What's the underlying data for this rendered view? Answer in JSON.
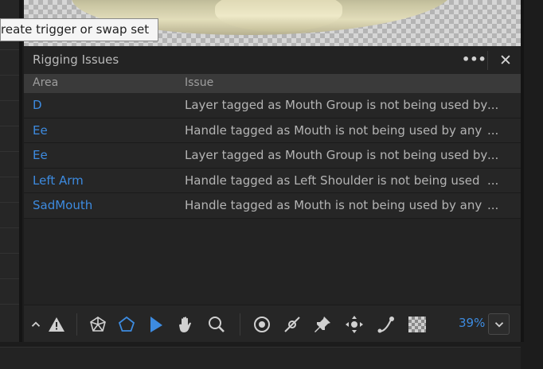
{
  "tooltip": {
    "text": "reate trigger or swap set"
  },
  "panel": {
    "title": "Rigging Issues",
    "more_label": "•••",
    "close_label": "✕"
  },
  "table": {
    "columns": [
      "Area",
      "Issue"
    ],
    "rows": [
      {
        "area": "D",
        "issue": "Layer tagged as Mouth Group is not being used by",
        "ellipsis": "..."
      },
      {
        "area": "Ee",
        "issue": "Handle tagged as Mouth is not being used by any",
        "ellipsis": "..."
      },
      {
        "area": "Ee",
        "issue": "Layer tagged as Mouth Group is not being used by",
        "ellipsis": "..."
      },
      {
        "area": "Left Arm",
        "issue": "Handle tagged as Left Shoulder is not being used",
        "ellipsis": "..."
      },
      {
        "area": "SadMouth",
        "issue": "Handle tagged as Mouth is not being used by any",
        "ellipsis": "..."
      }
    ]
  },
  "toolbar": {
    "tools": [
      {
        "icon": "chevron-up-icon"
      },
      {
        "icon": "warning-icon"
      },
      {
        "icon": "mesh-icon"
      },
      {
        "icon": "pentagon-icon",
        "active": true
      },
      {
        "icon": "selection-arrow-icon",
        "active": true
      },
      {
        "icon": "hand-icon"
      },
      {
        "icon": "zoom-icon"
      },
      {
        "icon": "origin-target-icon"
      },
      {
        "icon": "stick-icon"
      },
      {
        "icon": "pin-icon"
      },
      {
        "icon": "dragger-icon"
      },
      {
        "icon": "bend-icon"
      },
      {
        "icon": "transparency-grid-icon"
      }
    ],
    "zoom": "39%"
  },
  "colors": {
    "accent": "#3d8be0",
    "panel_bg": "#232323",
    "header_row_bg": "#3a3a3a"
  }
}
